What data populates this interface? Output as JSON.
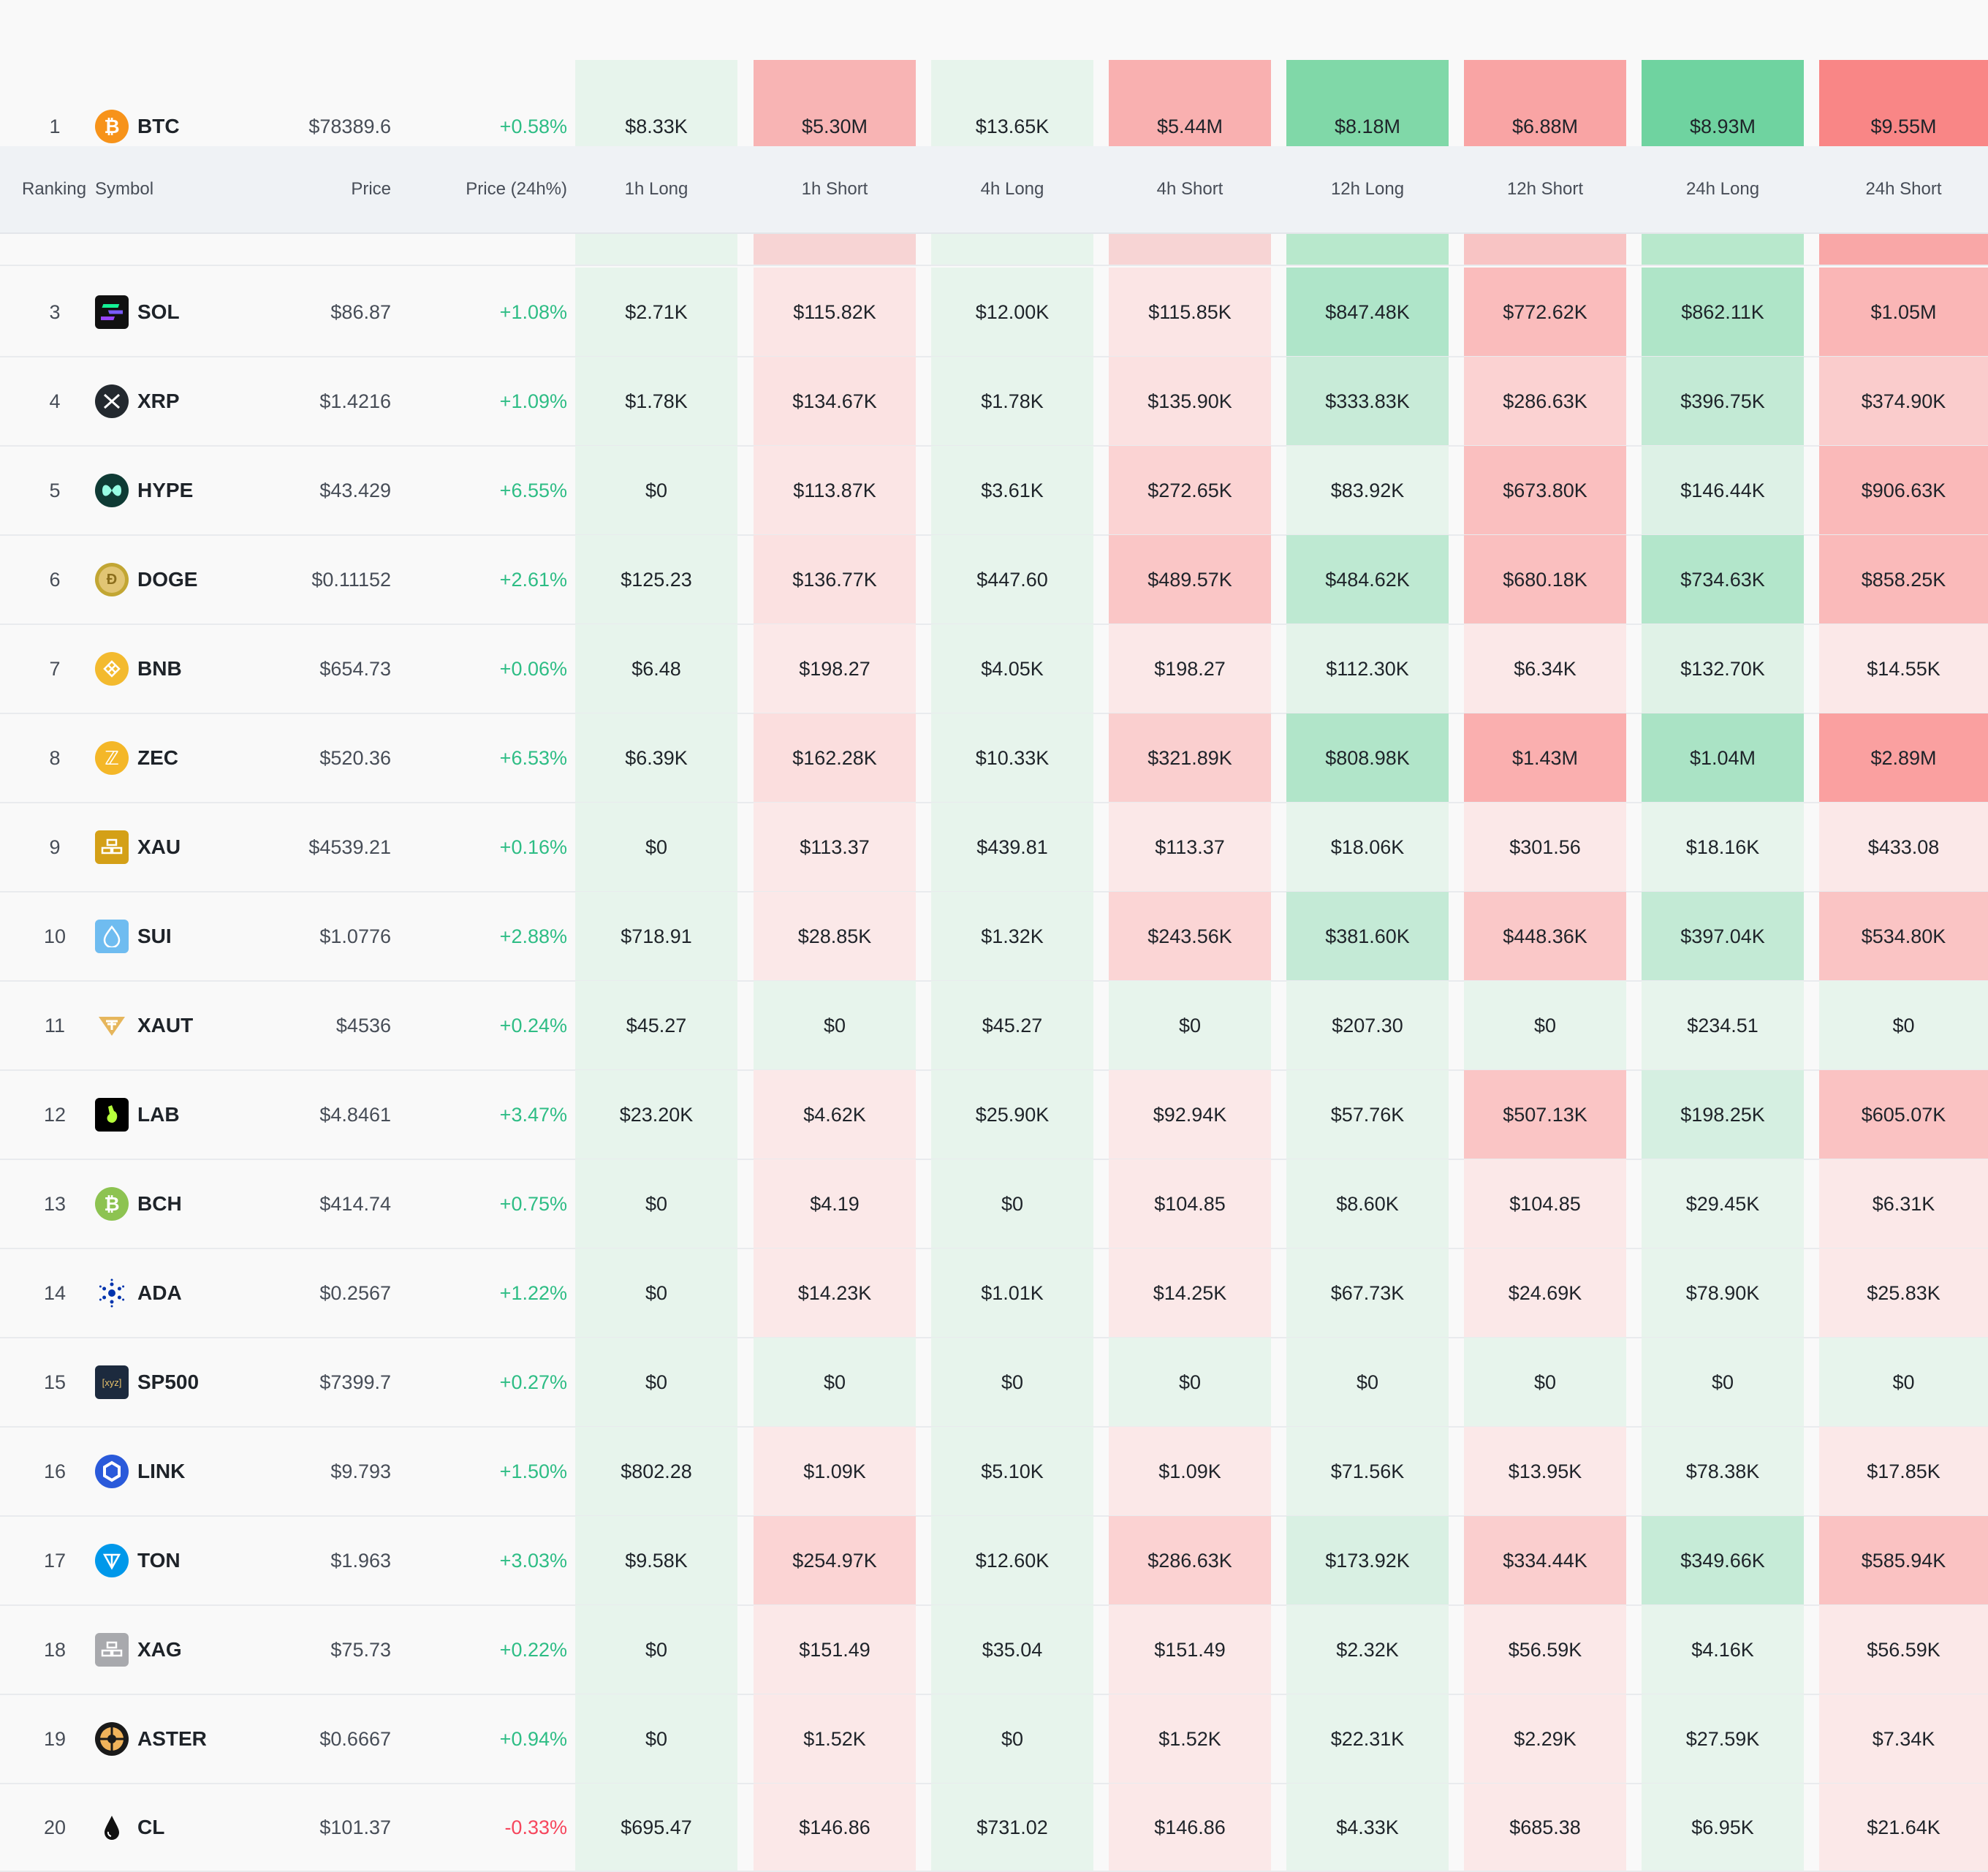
{
  "header": {
    "ranking": "Ranking",
    "symbol": "Symbol",
    "price": "Price",
    "change": "Price (24h%)",
    "h1_long": "1h Long",
    "h1_short": "1h Short",
    "h4_long": "4h Long",
    "h4_short": "4h Short",
    "h12_long": "12h Long",
    "h12_short": "12h Short",
    "h24_long": "24h Long",
    "h24_short": "24h Short"
  },
  "colors": {
    "long_base": "#e7f4ec",
    "short_base": "#fbe8e8",
    "positive_text": "#2ebd85",
    "negative_text": "#f6465d"
  },
  "rows": [
    {
      "rank": "1",
      "symbol": "BTC",
      "icon": "bitcoin-icon",
      "price": "$78389.6",
      "change": "+0.58%",
      "dir": "up",
      "cells": [
        "$8.33K",
        "$5.30M",
        "$13.65K",
        "$5.44M",
        "$8.18M",
        "$6.88M",
        "$8.93M",
        "$9.55M"
      ]
    },
    {
      "rank": "3",
      "symbol": "SOL",
      "icon": "solana-icon",
      "price": "$86.87",
      "change": "+1.08%",
      "dir": "up",
      "cells": [
        "$2.71K",
        "$115.82K",
        "$12.00K",
        "$115.85K",
        "$847.48K",
        "$772.62K",
        "$862.11K",
        "$1.05M"
      ]
    },
    {
      "rank": "4",
      "symbol": "XRP",
      "icon": "xrp-icon",
      "price": "$1.4216",
      "change": "+1.09%",
      "dir": "up",
      "cells": [
        "$1.78K",
        "$134.67K",
        "$1.78K",
        "$135.90K",
        "$333.83K",
        "$286.63K",
        "$396.75K",
        "$374.90K"
      ]
    },
    {
      "rank": "5",
      "symbol": "HYPE",
      "icon": "hype-icon",
      "price": "$43.429",
      "change": "+6.55%",
      "dir": "up",
      "cells": [
        "$0",
        "$113.87K",
        "$3.61K",
        "$272.65K",
        "$83.92K",
        "$673.80K",
        "$146.44K",
        "$906.63K"
      ]
    },
    {
      "rank": "6",
      "symbol": "DOGE",
      "icon": "doge-icon",
      "price": "$0.11152",
      "change": "+2.61%",
      "dir": "up",
      "cells": [
        "$125.23",
        "$136.77K",
        "$447.60",
        "$489.57K",
        "$484.62K",
        "$680.18K",
        "$734.63K",
        "$858.25K"
      ]
    },
    {
      "rank": "7",
      "symbol": "BNB",
      "icon": "bnb-icon",
      "price": "$654.73",
      "change": "+0.06%",
      "dir": "up",
      "cells": [
        "$6.48",
        "$198.27",
        "$4.05K",
        "$198.27",
        "$112.30K",
        "$6.34K",
        "$132.70K",
        "$14.55K"
      ]
    },
    {
      "rank": "8",
      "symbol": "ZEC",
      "icon": "zcash-icon",
      "price": "$520.36",
      "change": "+6.53%",
      "dir": "up",
      "cells": [
        "$6.39K",
        "$162.28K",
        "$10.33K",
        "$321.89K",
        "$808.98K",
        "$1.43M",
        "$1.04M",
        "$2.89M"
      ]
    },
    {
      "rank": "9",
      "symbol": "XAU",
      "icon": "gold-bars-icon",
      "price": "$4539.21",
      "change": "+0.16%",
      "dir": "up",
      "cells": [
        "$0",
        "$113.37",
        "$439.81",
        "$113.37",
        "$18.06K",
        "$301.56",
        "$18.16K",
        "$433.08"
      ]
    },
    {
      "rank": "10",
      "symbol": "SUI",
      "icon": "sui-droplet-icon",
      "price": "$1.0776",
      "change": "+2.88%",
      "dir": "up",
      "cells": [
        "$718.91",
        "$28.85K",
        "$1.32K",
        "$243.56K",
        "$381.60K",
        "$448.36K",
        "$397.04K",
        "$534.80K"
      ]
    },
    {
      "rank": "11",
      "symbol": "XAUT",
      "icon": "tether-gold-icon",
      "price": "$4536",
      "change": "+0.24%",
      "dir": "up",
      "cells": [
        "$45.27",
        "$0",
        "$45.27",
        "$0",
        "$207.30",
        "$0",
        "$234.51",
        "$0"
      ]
    },
    {
      "rank": "12",
      "symbol": "LAB",
      "icon": "lab-icon",
      "price": "$4.8461",
      "change": "+3.47%",
      "dir": "up",
      "cells": [
        "$23.20K",
        "$4.62K",
        "$25.90K",
        "$92.94K",
        "$57.76K",
        "$507.13K",
        "$198.25K",
        "$605.07K"
      ]
    },
    {
      "rank": "13",
      "symbol": "BCH",
      "icon": "bitcoin-cash-icon",
      "price": "$414.74",
      "change": "+0.75%",
      "dir": "up",
      "cells": [
        "$0",
        "$4.19",
        "$0",
        "$104.85",
        "$8.60K",
        "$104.85",
        "$29.45K",
        "$6.31K"
      ]
    },
    {
      "rank": "14",
      "symbol": "ADA",
      "icon": "cardano-icon",
      "price": "$0.2567",
      "change": "+1.22%",
      "dir": "up",
      "cells": [
        "$0",
        "$14.23K",
        "$1.01K",
        "$14.25K",
        "$67.73K",
        "$24.69K",
        "$78.90K",
        "$25.83K"
      ]
    },
    {
      "rank": "15",
      "symbol": "SP500",
      "icon": "xyz-icon",
      "icon_text": "[xyz]",
      "price": "$7399.7",
      "change": "+0.27%",
      "dir": "up",
      "cells": [
        "$0",
        "$0",
        "$0",
        "$0",
        "$0",
        "$0",
        "$0",
        "$0"
      ]
    },
    {
      "rank": "16",
      "symbol": "LINK",
      "icon": "chainlink-icon",
      "price": "$9.793",
      "change": "+1.50%",
      "dir": "up",
      "cells": [
        "$802.28",
        "$1.09K",
        "$5.10K",
        "$1.09K",
        "$71.56K",
        "$13.95K",
        "$78.38K",
        "$17.85K"
      ]
    },
    {
      "rank": "17",
      "symbol": "TON",
      "icon": "toncoin-icon",
      "price": "$1.963",
      "change": "+3.03%",
      "dir": "up",
      "cells": [
        "$9.58K",
        "$254.97K",
        "$12.60K",
        "$286.63K",
        "$173.92K",
        "$334.44K",
        "$349.66K",
        "$585.94K"
      ]
    },
    {
      "rank": "18",
      "symbol": "XAG",
      "icon": "silver-bars-icon",
      "price": "$75.73",
      "change": "+0.22%",
      "dir": "up",
      "cells": [
        "$0",
        "$151.49",
        "$35.04",
        "$151.49",
        "$2.32K",
        "$56.59K",
        "$4.16K",
        "$56.59K"
      ]
    },
    {
      "rank": "19",
      "symbol": "ASTER",
      "icon": "aster-icon",
      "price": "$0.6667",
      "change": "+0.94%",
      "dir": "up",
      "cells": [
        "$0",
        "$1.52K",
        "$0",
        "$1.52K",
        "$22.31K",
        "$2.29K",
        "$27.59K",
        "$7.34K"
      ]
    },
    {
      "rank": "20",
      "symbol": "CL",
      "icon": "oil-drop-icon",
      "price": "$101.37",
      "change": "-0.33%",
      "dir": "down",
      "cells": [
        "$695.47",
        "$146.86",
        "$731.02",
        "$146.86",
        "$4.33K",
        "$685.38",
        "$6.95K",
        "$21.64K"
      ]
    }
  ]
}
